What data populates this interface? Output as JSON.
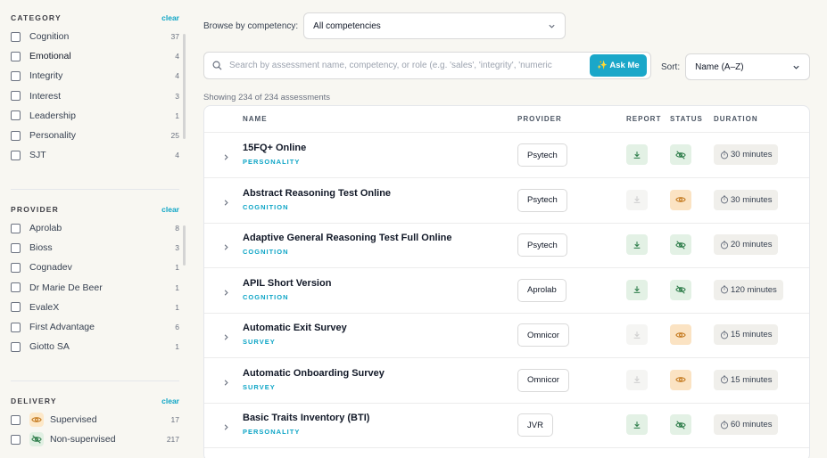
{
  "sidebar": {
    "category": {
      "title": "CATEGORY",
      "clear": "clear",
      "items": [
        {
          "label": "Cognition",
          "count": "37"
        },
        {
          "label": "Emotional",
          "count": "4"
        },
        {
          "label": "Integrity",
          "count": "4"
        },
        {
          "label": "Interest",
          "count": "3"
        },
        {
          "label": "Leadership",
          "count": "1"
        },
        {
          "label": "Personality",
          "count": "25"
        },
        {
          "label": "SJT",
          "count": "4"
        }
      ]
    },
    "provider": {
      "title": "PROVIDER",
      "clear": "clear",
      "items": [
        {
          "label": "Aprolab",
          "count": "8"
        },
        {
          "label": "Bioss",
          "count": "3"
        },
        {
          "label": "Cognadev",
          "count": "1"
        },
        {
          "label": "Dr Marie De Beer",
          "count": "1"
        },
        {
          "label": "EvaleX",
          "count": "1"
        },
        {
          "label": "First Advantage",
          "count": "6"
        },
        {
          "label": "Giotto SA",
          "count": "1"
        }
      ]
    },
    "delivery": {
      "title": "DELIVERY",
      "clear": "clear",
      "items": [
        {
          "label": "Supervised",
          "count": "17",
          "icon": "eye-icon"
        },
        {
          "label": "Non-supervised",
          "count": "217",
          "icon": "eye-off-icon"
        }
      ]
    }
  },
  "toolbar": {
    "browse_label": "Browse by competency:",
    "competency_value": "All competencies",
    "search_placeholder": "Search by assessment name, competency, or role (e.g. 'sales', 'integrity', 'numeric",
    "ask_label": "✨ Ask Me",
    "sort_label": "Sort:",
    "sort_value": "Name (A–Z)",
    "showing": "Showing 234 of 234 assessments"
  },
  "table": {
    "headers": {
      "name": "NAME",
      "provider": "PROVIDER",
      "report": "REPORT",
      "status": "STATUS",
      "duration": "DURATION"
    },
    "rows": [
      {
        "name": "15FQ+ Online",
        "category": "PERSONALITY",
        "provider": "Psytech",
        "report": true,
        "status": "non-supervised",
        "duration": "30 minutes"
      },
      {
        "name": "Abstract Reasoning Test Online",
        "category": "COGNITION",
        "provider": "Psytech",
        "report": false,
        "status": "supervised",
        "duration": "30 minutes"
      },
      {
        "name": "Adaptive General Reasoning Test Full Online",
        "category": "COGNITION",
        "provider": "Psytech",
        "report": true,
        "status": "non-supervised",
        "duration": "20 minutes"
      },
      {
        "name": "APIL Short Version",
        "category": "COGNITION",
        "provider": "Aprolab",
        "report": true,
        "status": "non-supervised",
        "duration": "120 minutes"
      },
      {
        "name": "Automatic Exit Survey",
        "category": "SURVEY",
        "provider": "Omnicor",
        "report": false,
        "status": "supervised",
        "duration": "15 minutes"
      },
      {
        "name": "Automatic Onboarding Survey",
        "category": "SURVEY",
        "provider": "Omnicor",
        "report": false,
        "status": "supervised",
        "duration": "15 minutes"
      },
      {
        "name": "Basic Traits Inventory (BTI)",
        "category": "PERSONALITY",
        "provider": "JVR",
        "report": true,
        "status": "non-supervised",
        "duration": "60 minutes"
      }
    ]
  },
  "colors": {
    "accent": "#1aa7c9",
    "green_bg": "#e3f1e5",
    "green_icon": "#2e7d4a",
    "orange_bg": "#fbe3c3",
    "orange_icon": "#c2761a"
  }
}
